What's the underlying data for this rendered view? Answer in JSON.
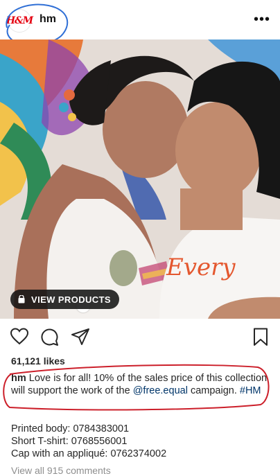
{
  "header": {
    "avatar_text": "H&M",
    "username": "hm",
    "more_label": "•••"
  },
  "photo": {
    "view_products_label": "VIEW PRODUCTS",
    "shirt_text": "Every"
  },
  "actions": {
    "icons": [
      "heart-icon",
      "comment-icon",
      "share-icon",
      "bookmark-icon"
    ]
  },
  "post": {
    "likes": "61,121 likes",
    "caption_user": "hm",
    "caption_text": "Love is for all! 10% of the sales price of this collection will support the work of the ",
    "caption_mention": "@free.equal",
    "caption_after": " campaign. ",
    "caption_hashtag": "#HM",
    "product_lines": [
      "Printed body: 0784383001",
      "Short T-shirt: 0768556001",
      "Cap with an appliqué: 0762374002"
    ],
    "view_comments": "View all 915 comments"
  },
  "colors": {
    "annotation": "#cc1f2a",
    "annotation_blue": "#2f6fd6",
    "link": "#003569"
  }
}
